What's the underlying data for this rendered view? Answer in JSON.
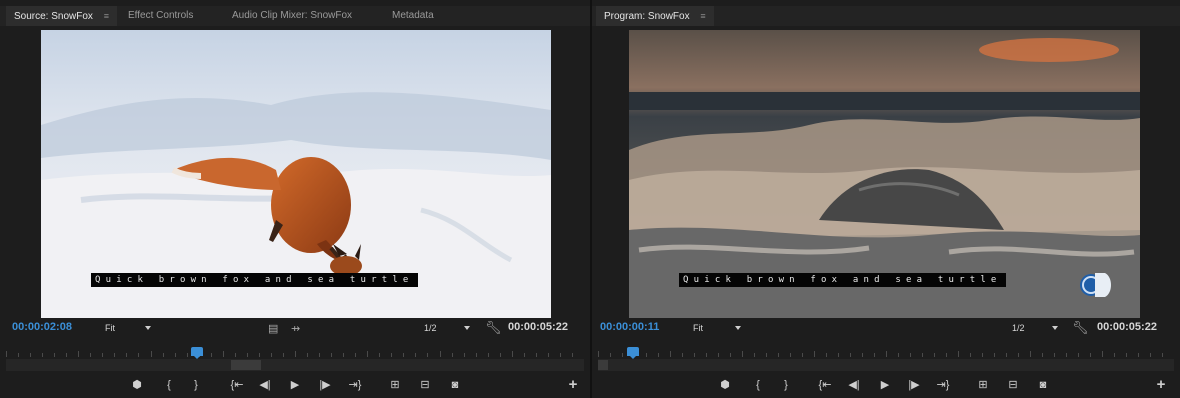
{
  "source": {
    "tabs": [
      {
        "label": "Source: SnowFox",
        "active": true
      },
      {
        "label": "Effect Controls",
        "active": false
      },
      {
        "label": "Audio Clip Mixer: SnowFox",
        "active": false
      },
      {
        "label": "Metadata",
        "active": false
      }
    ],
    "caption": "Quick brown fox and sea turtle",
    "current_timecode": "00:00:02:08",
    "duration_timecode": "00:00:05:22",
    "zoom": "Fit",
    "resolution": "1/2",
    "playhead_fraction": 0.33
  },
  "program": {
    "title": "Program: SnowFox",
    "caption": "Quick brown fox and sea turtle",
    "current_timecode": "00:00:00:11",
    "duration_timecode": "00:00:05:22",
    "zoom": "Fit",
    "resolution": "1/2",
    "playhead_fraction": 0.06
  },
  "icons": {
    "menu": "panel-menu-icon",
    "settings": "wrench-icon",
    "add": "plus-icon"
  },
  "colors": {
    "timecode_current": "#3b8fd7",
    "panel_background": "#1d1d1d"
  }
}
